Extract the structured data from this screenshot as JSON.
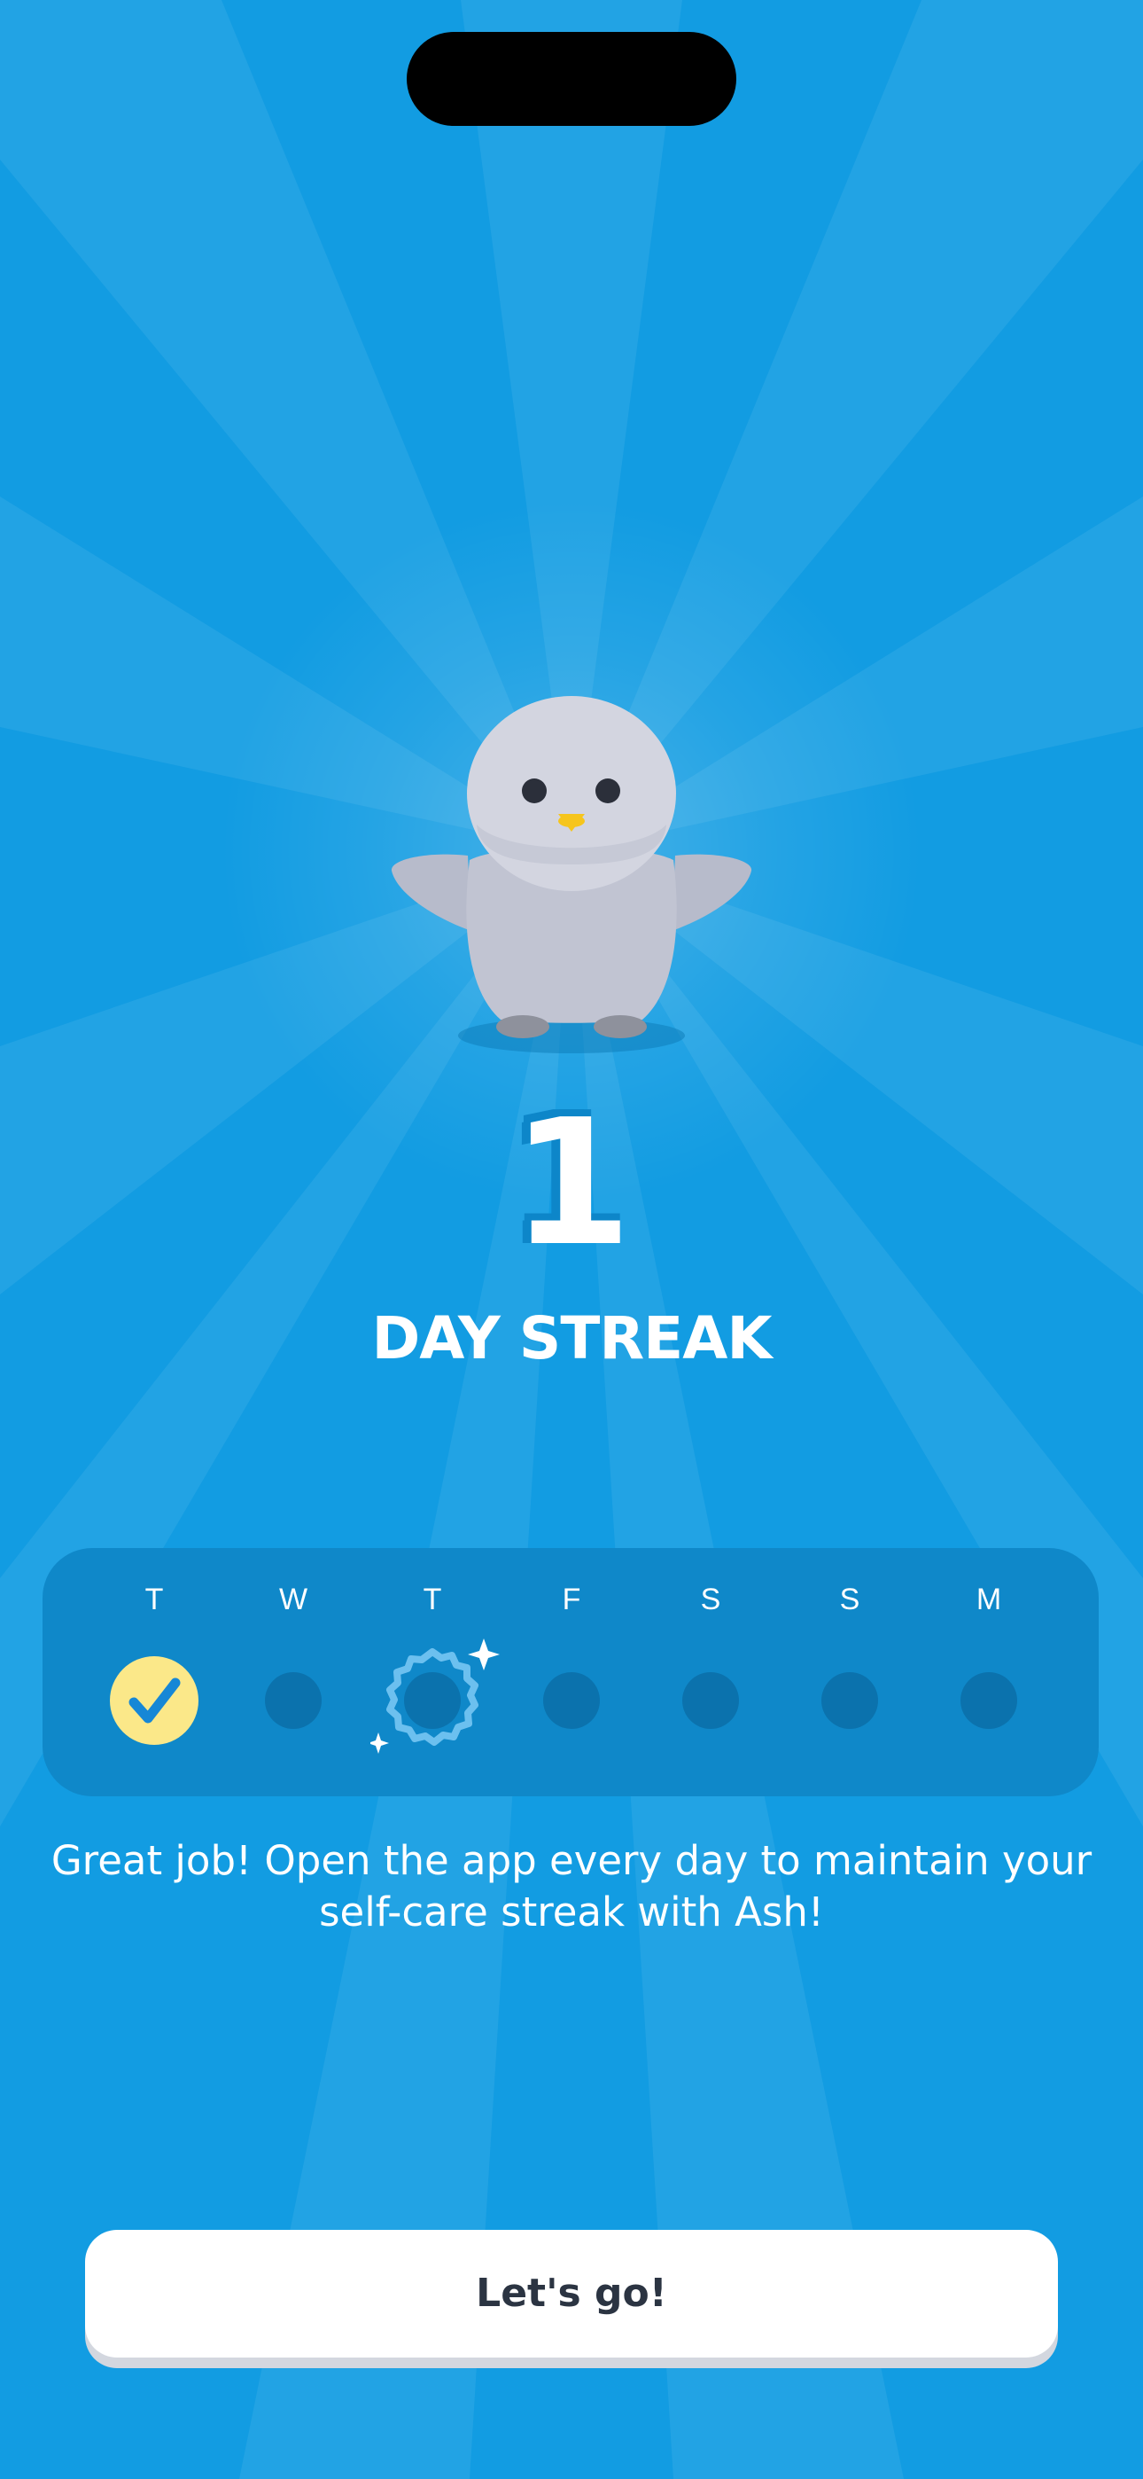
{
  "streak": {
    "count": "1",
    "label": "DAY STREAK"
  },
  "week": {
    "days": [
      {
        "letter": "T",
        "state": "done"
      },
      {
        "letter": "W",
        "state": "empty"
      },
      {
        "letter": "T",
        "state": "today"
      },
      {
        "letter": "F",
        "state": "empty"
      },
      {
        "letter": "S",
        "state": "empty"
      },
      {
        "letter": "S",
        "state": "empty"
      },
      {
        "letter": "M",
        "state": "empty"
      }
    ]
  },
  "message": "Great job! Open the app every day to maintain your self-care streak with Ash!",
  "cta": {
    "label": "Let's go!"
  },
  "colors": {
    "background": "#129ce2",
    "card": "#0f88c9",
    "dot": "#0b72ad",
    "check_fill": "#fbe889",
    "check_mark": "#1687d6",
    "button_text": "#2b3442"
  },
  "icons": {
    "mascot": "owl-mascot",
    "done": "check-icon",
    "today": "sparkle-badge-icon"
  }
}
